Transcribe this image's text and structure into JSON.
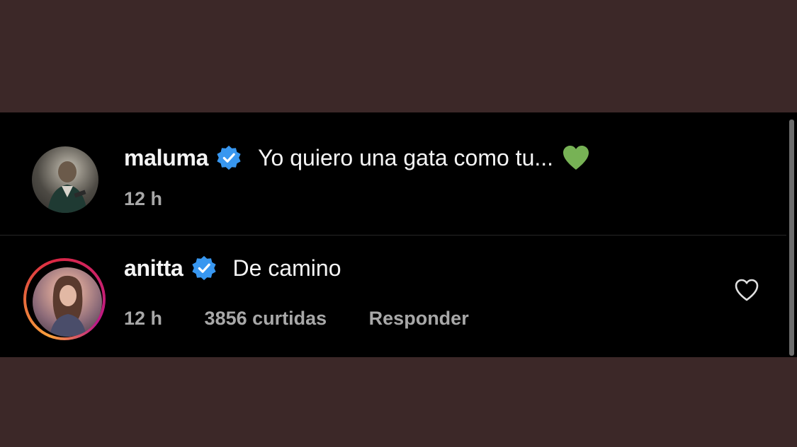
{
  "comments": [
    {
      "username": "maluma",
      "verified": true,
      "text": "Yo quiero una gata como tu...",
      "emoji": "green-heart",
      "time": "12 h"
    },
    {
      "username": "anitta",
      "verified": true,
      "text": "De camino",
      "time": "12 h",
      "likes": "3856 curtidas",
      "reply_label": "Responder",
      "has_story_ring": true
    }
  ],
  "colors": {
    "background_outer": "#3c2828",
    "panel": "#000000",
    "text_primary": "#f5f5f5",
    "text_secondary": "#a8a8a8",
    "verified_blue": "#3897f0",
    "green_heart": "#77b255"
  },
  "icons": {
    "verified": "verified-badge-icon",
    "like": "heart-outline-icon",
    "emoji": "green-heart-emoji"
  }
}
